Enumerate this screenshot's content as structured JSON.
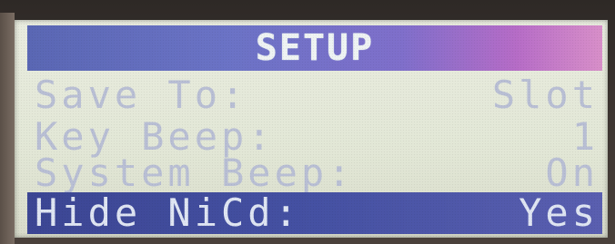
{
  "screen": {
    "title": "SETUP"
  },
  "menu": {
    "items": [
      {
        "label": "Save To:",
        "value": "Slot"
      },
      {
        "label": "Key Beep:",
        "value": "1"
      },
      {
        "label": "System Beep:",
        "value": "On"
      },
      {
        "label": "Hide NiCd:",
        "value": "Yes"
      }
    ],
    "selected_index": 3
  },
  "colors": {
    "title_bar_start": "#5a67b4",
    "title_bar_end": "#d88fc9",
    "screen_background": "#e6e9dc",
    "text": "#b9bfd4",
    "selected_background": "#4551a3",
    "selected_text": "#dfe5f2"
  }
}
